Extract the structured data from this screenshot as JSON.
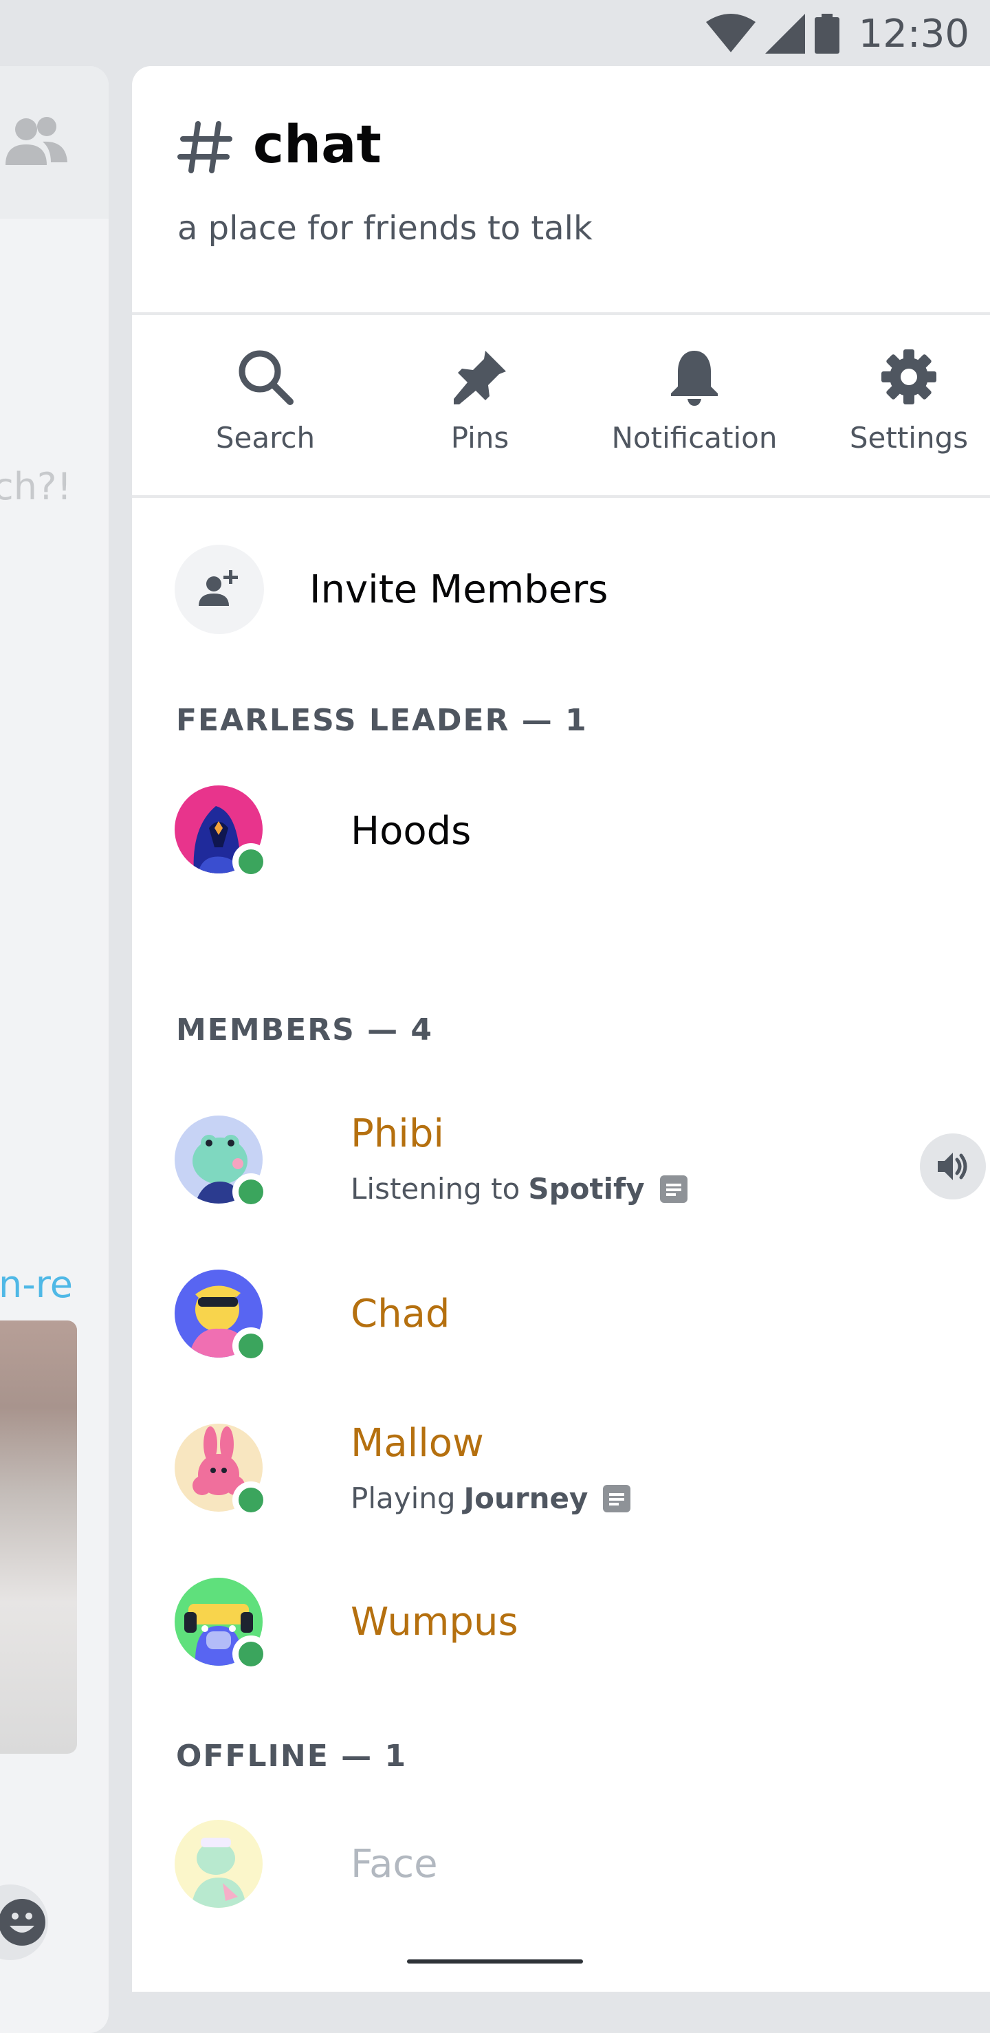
{
  "status_bar": {
    "time": "12:30",
    "icons": [
      "wifi-icon",
      "signal-icon",
      "battery-icon"
    ]
  },
  "background_chat": {
    "fragment_1": "ch?!",
    "fragment_2": "n-re"
  },
  "channel": {
    "name": "chat",
    "topic": "a place for friends to talk"
  },
  "actions": [
    {
      "label": "Search",
      "icon": "search-icon"
    },
    {
      "label": "Pins",
      "icon": "pin-icon"
    },
    {
      "label": "Notification",
      "icon": "bell-icon"
    },
    {
      "label": "Settings",
      "icon": "gear-icon"
    }
  ],
  "invite": {
    "label": "Invite Members",
    "icon": "add-person-icon"
  },
  "sections": {
    "leader": "FEARLESS LEADER — 1",
    "members": "MEMBERS — 4",
    "offline": "OFFLINE — 1"
  },
  "members": {
    "hoods": {
      "name": "Hoods",
      "status": "online"
    },
    "phibi": {
      "name": "Phibi",
      "activity_prefix": "Listening to",
      "activity_name": "Spotify",
      "status": "online",
      "in_voice": true
    },
    "chad": {
      "name": "Chad",
      "status": "online"
    },
    "mallow": {
      "name": "Mallow",
      "activity_prefix": "Playing",
      "activity_name": "Journey",
      "status": "online"
    },
    "wumpus": {
      "name": "Wumpus",
      "status": "online"
    },
    "face": {
      "name": "Face",
      "status": "offline"
    }
  },
  "colors": {
    "member_name": "#b5700f",
    "leader_name": "#060607",
    "offline_name": "#a3a6aa",
    "online_dot": "#3ba55d",
    "link_blue": "#4fb8e6"
  }
}
